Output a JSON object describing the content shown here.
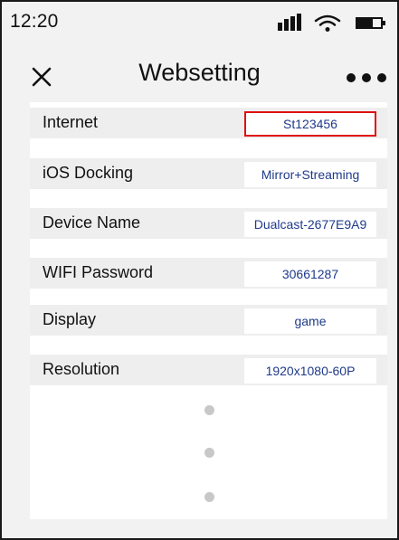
{
  "status_bar": {
    "time": "12:20",
    "icons": [
      "signal-icon",
      "wifi-icon",
      "battery-icon"
    ]
  },
  "header": {
    "title": "Websetting",
    "close_icon": "close-icon",
    "more_icon": "more-icon"
  },
  "settings": [
    {
      "label": "Internet",
      "value": "St123456",
      "selected": true
    },
    {
      "label": "iOS Docking",
      "value": "Mirror+Streaming",
      "selected": false
    },
    {
      "label": "Device Name",
      "value": "Dualcast-2677E9A9",
      "selected": false
    },
    {
      "label": "WIFI Password",
      "value": "30661287",
      "selected": false
    },
    {
      "label": "Display",
      "value": "game",
      "selected": false
    },
    {
      "label": "Resolution",
      "value": "1920x1080-60P",
      "selected": false
    }
  ],
  "colors": {
    "value_text": "#1f3a8a",
    "selected_border": "#e01010",
    "row_background": "#eeeeee",
    "page_background": "#f2f2f2"
  }
}
